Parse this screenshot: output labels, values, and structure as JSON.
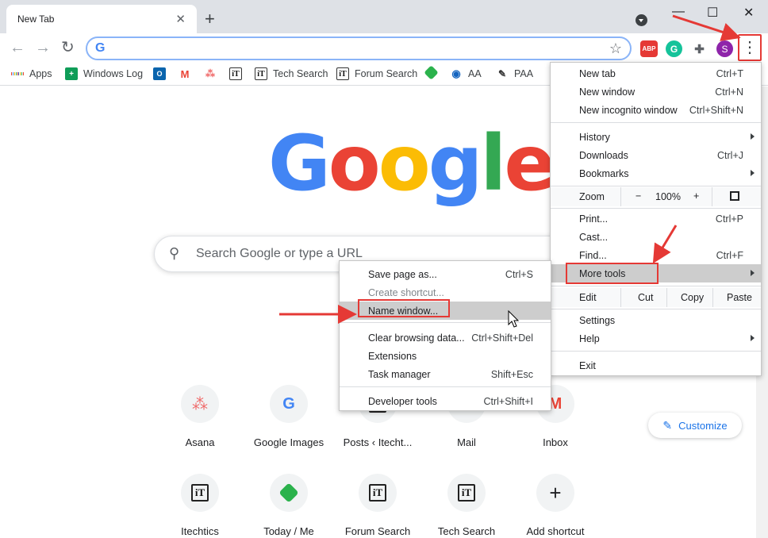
{
  "tab": {
    "title": "New Tab",
    "close": "✕"
  },
  "window": {
    "new_tab": "+",
    "minimize": "—",
    "maximize": "☐",
    "close": "✕"
  },
  "toolbar": {
    "back": "←",
    "forward": "→",
    "reload": "↻",
    "omni_g": "G",
    "star": "☆",
    "kebab": "⋮",
    "abp": "ABP",
    "grammarly": "G",
    "extensions": "✚",
    "profile": "S"
  },
  "bookmarks": [
    {
      "label": "Apps",
      "icon": "apps-grid-icon"
    },
    {
      "label": "Windows Log",
      "icon": "sheets-icon"
    },
    {
      "label": "",
      "icon": "outlook-icon"
    },
    {
      "label": "",
      "icon": "gmail-icon"
    },
    {
      "label": "",
      "icon": "asana-icon"
    },
    {
      "label": "",
      "icon": "itechtics-icon"
    },
    {
      "label": "Tech Search",
      "icon": "itechtics-icon"
    },
    {
      "label": "Forum Search",
      "icon": "itechtics-icon"
    },
    {
      "label": "",
      "icon": "feedly-icon"
    },
    {
      "label": "AA",
      "icon": "eye-icon"
    },
    {
      "label": "PAA",
      "icon": "pen-icon"
    }
  ],
  "google_logo": [
    "G",
    "o",
    "o",
    "g",
    "l",
    "e"
  ],
  "search": {
    "placeholder": "Search Google or type a URL"
  },
  "shortcuts_row1": [
    {
      "label": "Asana",
      "icon": "asana-icon"
    },
    {
      "label": "Google Images",
      "icon": "google-g-icon"
    },
    {
      "label": "Posts ‹ Itecht...",
      "icon": "itechtics-icon"
    },
    {
      "label": "Mail",
      "icon": "gmail-icon"
    },
    {
      "label": "Inbox",
      "icon": "gmail-icon"
    }
  ],
  "shortcuts_row2": [
    {
      "label": "Itechtics",
      "icon": "itechtics-icon"
    },
    {
      "label": "Today / Me",
      "icon": "feedly-icon"
    },
    {
      "label": "Forum Search",
      "icon": "itechtics-icon"
    },
    {
      "label": "Tech Search",
      "icon": "itechtics-icon"
    },
    {
      "label": "Add shortcut",
      "icon": "plus-icon"
    }
  ],
  "customize": {
    "label": "Customize"
  },
  "main_menu": {
    "new_tab": {
      "label": "New tab",
      "shortcut": "Ctrl+T"
    },
    "new_window": {
      "label": "New window",
      "shortcut": "Ctrl+N"
    },
    "new_incognito": {
      "label": "New incognito window",
      "shortcut": "Ctrl+Shift+N"
    },
    "history": {
      "label": "History"
    },
    "downloads": {
      "label": "Downloads",
      "shortcut": "Ctrl+J"
    },
    "bookmarks": {
      "label": "Bookmarks"
    },
    "zoom": {
      "label": "Zoom",
      "minus": "−",
      "value": "100%",
      "plus": "+"
    },
    "print": {
      "label": "Print...",
      "shortcut": "Ctrl+P"
    },
    "cast": {
      "label": "Cast..."
    },
    "find": {
      "label": "Find...",
      "shortcut": "Ctrl+F"
    },
    "more_tools": {
      "label": "More tools"
    },
    "edit": {
      "label": "Edit",
      "cut": "Cut",
      "copy": "Copy",
      "paste": "Paste"
    },
    "settings": {
      "label": "Settings"
    },
    "help": {
      "label": "Help"
    },
    "exit": {
      "label": "Exit"
    }
  },
  "sub_menu": {
    "save_page": {
      "label": "Save page as...",
      "shortcut": "Ctrl+S"
    },
    "create_shortcut": {
      "label": "Create shortcut..."
    },
    "name_window": {
      "label": "Name window..."
    },
    "clear_browsing": {
      "label": "Clear browsing data...",
      "shortcut": "Ctrl+Shift+Del"
    },
    "extensions": {
      "label": "Extensions"
    },
    "task_manager": {
      "label": "Task manager",
      "shortcut": "Shift+Esc"
    },
    "developer_tools": {
      "label": "Developer tools",
      "shortcut": "Ctrl+Shift+I"
    }
  },
  "colors": {
    "annotation_red": "#e53935",
    "highlight": "#cdcdcd",
    "google_blue": "#4285f4",
    "google_red": "#ea4335",
    "google_yellow": "#fbbc05",
    "google_green": "#34a853"
  }
}
